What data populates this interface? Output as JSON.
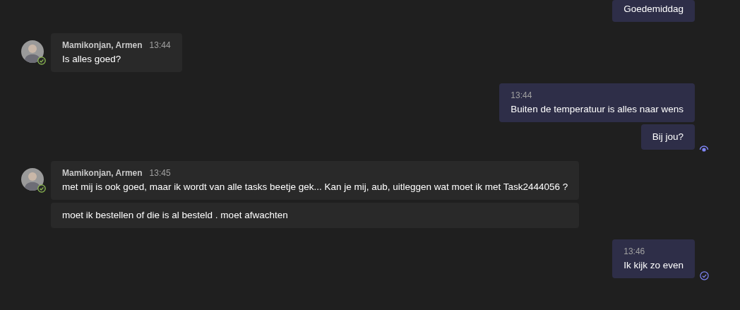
{
  "messages": [
    {
      "kind": "outgoing",
      "bubbles": [
        {
          "text": "Goedemiddag"
        }
      ]
    },
    {
      "kind": "incoming",
      "sender": "Mamikonjan, Armen",
      "time": "13:44",
      "online": true,
      "bubbles": [
        {
          "text": "Is alles goed?"
        }
      ]
    },
    {
      "kind": "outgoing",
      "time": "13:44",
      "read": true,
      "bubbles": [
        {
          "text": "Buiten de temperatuur is alles naar wens"
        },
        {
          "text": "Bij jou?"
        }
      ]
    },
    {
      "kind": "incoming",
      "sender": "Mamikonjan, Armen",
      "time": "13:45",
      "online": true,
      "bubbles": [
        {
          "text": "met mij is ook goed, maar ik wordt van alle tasks beetje gek... Kan je mij, aub, uitleggen wat moet ik met Task2444056 ?"
        },
        {
          "text": "moet ik bestellen of die is al besteld . moet afwachten"
        }
      ]
    },
    {
      "kind": "outgoing",
      "time": "13:46",
      "read": false,
      "bubbles": [
        {
          "text": "Ik kijk zo even"
        }
      ]
    }
  ]
}
